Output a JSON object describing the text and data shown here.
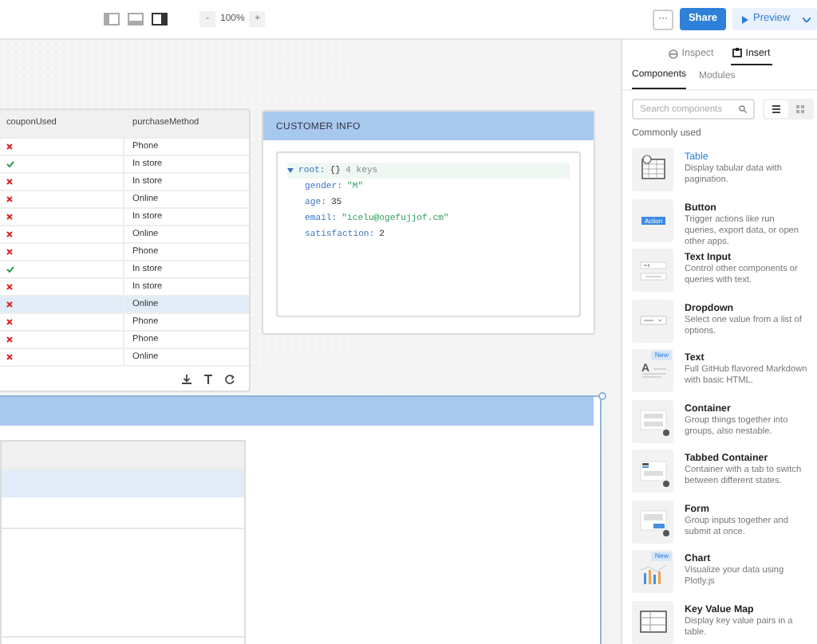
{
  "toolbar": {
    "layout_toggles": [
      {
        "kind": "left",
        "selected": false
      },
      {
        "kind": "bottom",
        "selected": false
      },
      {
        "kind": "right",
        "selected": true
      }
    ],
    "zoom_out": "-",
    "zoom": "100%",
    "zoom_in": "+",
    "more": "···",
    "share": "Share",
    "preview": "Preview"
  },
  "table": {
    "columns": [
      "couponUsed",
      "purchaseMethod"
    ],
    "rows": [
      {
        "coupon_used": false,
        "method": "Phone",
        "selected": false
      },
      {
        "coupon_used": true,
        "method": "In store",
        "selected": false
      },
      {
        "coupon_used": false,
        "method": "In store",
        "selected": false
      },
      {
        "coupon_used": false,
        "method": "Online",
        "selected": false
      },
      {
        "coupon_used": false,
        "method": "In store",
        "selected": false
      },
      {
        "coupon_used": false,
        "method": "Online",
        "selected": false
      },
      {
        "coupon_used": false,
        "method": "Phone",
        "selected": false
      },
      {
        "coupon_used": true,
        "method": "In store",
        "selected": false
      },
      {
        "coupon_used": false,
        "method": "In store",
        "selected": false
      },
      {
        "coupon_used": false,
        "method": "Online",
        "selected": true
      },
      {
        "coupon_used": false,
        "method": "Phone",
        "selected": false
      },
      {
        "coupon_used": false,
        "method": "Phone",
        "selected": false
      },
      {
        "coupon_used": false,
        "method": "Online",
        "selected": false
      }
    ]
  },
  "customer_info": {
    "title": "CUSTOMER INFO",
    "root": {
      "label": "root:",
      "braces": "{}",
      "count": "4 keys",
      "expanded": true
    },
    "entries": [
      {
        "key": "gender:",
        "value": "\"M\"",
        "kind": "string"
      },
      {
        "key": "age:",
        "value": "35",
        "kind": "number"
      },
      {
        "key": "email:",
        "value": "\"icelu@ogefujjof.cm\"",
        "kind": "string"
      },
      {
        "key": "satisfaction:",
        "value": "2",
        "kind": "number"
      }
    ]
  },
  "panel": {
    "tabs": [
      {
        "label": "Inspect",
        "kind": "inspect",
        "selected": false
      },
      {
        "label": "Insert",
        "kind": "insert",
        "selected": true
      }
    ],
    "subtabs": [
      {
        "label": "Components",
        "selected": true
      },
      {
        "label": "Modules",
        "selected": false
      }
    ],
    "search": {
      "placeholder": "Search components"
    },
    "view_modes": [
      {
        "kind": "list",
        "selected": true
      },
      {
        "kind": "grid",
        "selected": false
      }
    ],
    "section": "Commonly used",
    "components": [
      {
        "kind": "table",
        "name": "Table",
        "description": "Display tabular data with pagination.",
        "highlighted": true
      },
      {
        "kind": "button",
        "name": "Button",
        "description": "Trigger actions like run queries, export data, or open other apps.",
        "thumb_text": "Action",
        "highlighted": false
      },
      {
        "kind": "text-input",
        "name": "Text Input",
        "description": "Control other components or queries with text.",
        "highlighted": false
      },
      {
        "kind": "dropdown",
        "name": "Dropdown",
        "description": "Select one value from a list of options.",
        "highlighted": false
      },
      {
        "kind": "text",
        "name": "Text",
        "description": "Full GitHub flavored Markdown with basic HTML.",
        "thumb_text": "A",
        "badge": "New",
        "highlighted": false
      },
      {
        "kind": "container",
        "name": "Container",
        "description": "Group things together into groups, also nestable.",
        "highlighted": false
      },
      {
        "kind": "tabbed",
        "name": "Tabbed Container",
        "description": "Container with a tab to switch between different states.",
        "highlighted": false
      },
      {
        "kind": "form",
        "name": "Form",
        "description": "Group inputs together and submit at once.",
        "highlighted": false
      },
      {
        "kind": "chart",
        "name": "Chart",
        "description": "Visualize your data using Plotly.js",
        "badge": "New",
        "highlighted": false
      },
      {
        "kind": "kvmap",
        "name": "Key Value Map",
        "description": "Display key value pairs in a table.",
        "highlighted": false
      }
    ]
  }
}
